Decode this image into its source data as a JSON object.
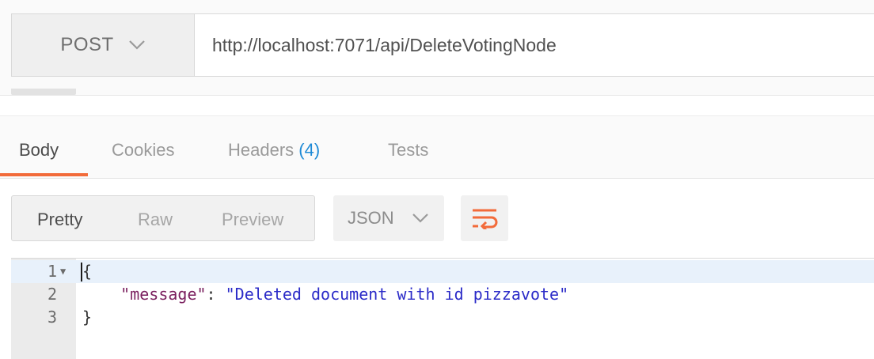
{
  "request": {
    "method": "POST",
    "url": "http://localhost:7071/api/DeleteVotingNode"
  },
  "response_tabs": [
    {
      "label": "Body",
      "active": true
    },
    {
      "label": "Cookies",
      "active": false
    },
    {
      "label": "Headers",
      "count": "(4)",
      "active": false
    },
    {
      "label": "Tests",
      "active": false
    }
  ],
  "view_modes": [
    {
      "label": "Pretty",
      "active": true
    },
    {
      "label": "Raw",
      "active": false
    },
    {
      "label": "Preview",
      "active": false
    }
  ],
  "format": {
    "selected": "JSON"
  },
  "icons": {
    "method_dropdown": "chevron-down-icon",
    "format_dropdown": "chevron-down-icon",
    "wrap": "wrap-lines-icon"
  },
  "colors": {
    "accent": "#f26b3a",
    "count": "#1e8ad6",
    "json_key": "#7a1f5e",
    "json_string": "#2b2bc8"
  },
  "code": {
    "lines": [
      {
        "num": "1",
        "text": "{"
      },
      {
        "num": "2",
        "key": "\"message\"",
        "sep": ": ",
        "value": "\"Deleted document with id pizzavote\""
      },
      {
        "num": "3",
        "text": "}"
      }
    ]
  }
}
